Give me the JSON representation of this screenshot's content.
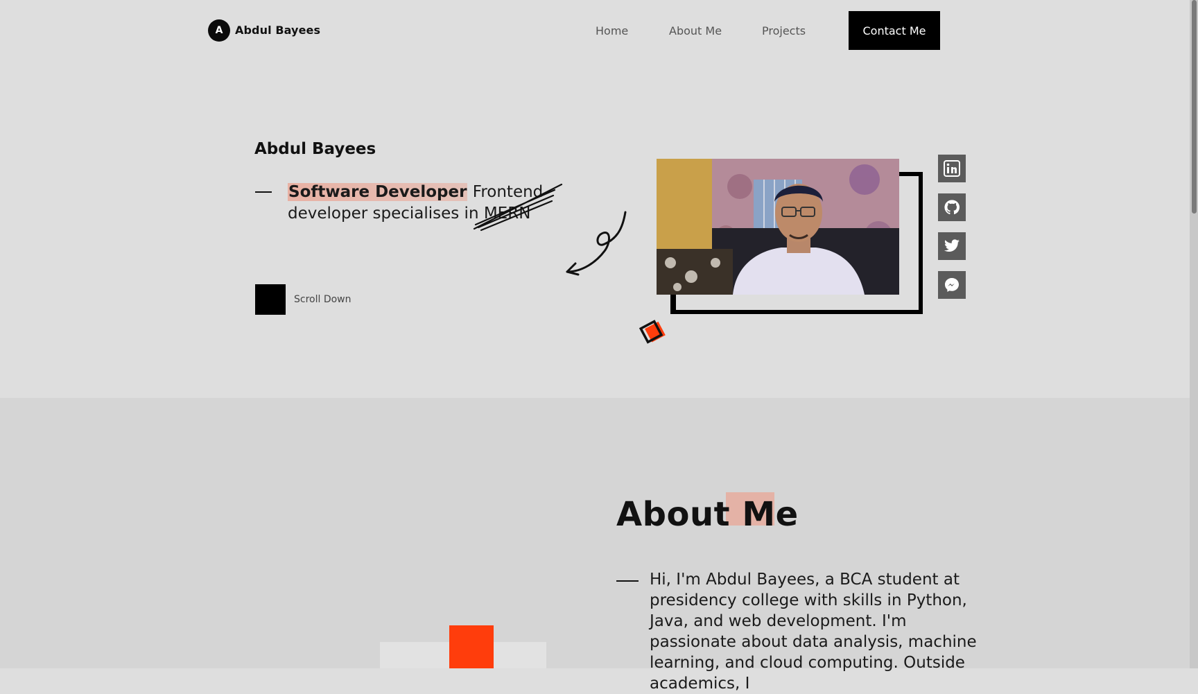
{
  "nav": {
    "logo_letter": "A",
    "logo_name": "Abdul Bayees",
    "links": [
      "Home",
      "About Me",
      "Projects"
    ],
    "contact_label": "Contact Me"
  },
  "hero": {
    "name": "Abdul Bayees",
    "role": "Software Developer",
    "tagline_rest": " Frontend developer specialises in MERN",
    "scroll_label": "Scroll Down",
    "social_icons": [
      "linkedin-icon",
      "github-icon",
      "twitter-icon",
      "messenger-icon"
    ]
  },
  "about": {
    "title": "About Me",
    "text": "Hi, I'm Abdul Bayees, a BCA student at presidency college with skills in Python, Java, and web development. I'm passionate about data analysis, machine learning, and cloud computing. Outside academics, I"
  },
  "colors": {
    "accent_orange": "#ff3d0c",
    "highlight_pink": "#e4b2a6",
    "background": "#dedede",
    "section_bg": "#d5d5d5"
  }
}
